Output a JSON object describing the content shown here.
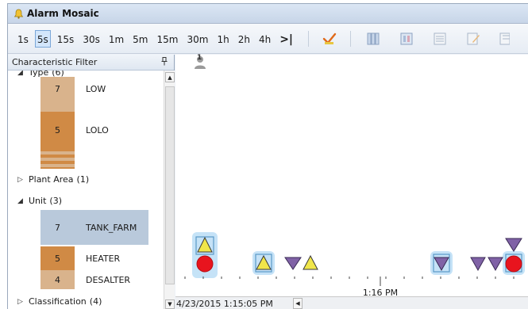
{
  "window": {
    "title": "Alarm Mosaic"
  },
  "toolbar": {
    "intervals": [
      "1s",
      "5s",
      "15s",
      "30s",
      "1m",
      "5m",
      "15m",
      "30m",
      "1h",
      "2h",
      "4h"
    ],
    "selected_interval": "5s",
    "end_glyph": ">|",
    "tools": [
      "acknowledge-icon",
      "columns-icon",
      "grid-icon",
      "list-icon",
      "edit-icon",
      "layout-icon"
    ]
  },
  "filter": {
    "title": "Characteristic Filter",
    "pin_glyph": "↕",
    "type": {
      "label": "Type",
      "count": "(6)"
    },
    "type_rows": [
      {
        "count": "7",
        "label": "LOW",
        "color": "#d9b38c"
      },
      {
        "count": "5",
        "label": "LOLO",
        "color": "#d08a45"
      }
    ],
    "plant_area": {
      "label": "Plant Area",
      "count": "(1)"
    },
    "unit": {
      "label": "Unit",
      "count": "(3)"
    },
    "unit_rows": [
      {
        "count": "7",
        "label": "TANK_FARM",
        "color": "#b9c9db"
      },
      {
        "count": "5",
        "label": "HEATER",
        "color": "#d08a45"
      },
      {
        "count": "4",
        "label": "DESALTER",
        "color": "#d9b38c"
      }
    ],
    "classification": {
      "label": "Classification",
      "count": "(4)"
    }
  },
  "mosaic": {
    "user_badge": "1",
    "time_label": "1:16 PM",
    "start_timestamp": "4/23/2015 1:15:05 PM",
    "colors": {
      "yellow": "#f0e64a",
      "red": "#e8141e",
      "purple": "#8062a6",
      "glow": "#8fc6ee"
    }
  }
}
